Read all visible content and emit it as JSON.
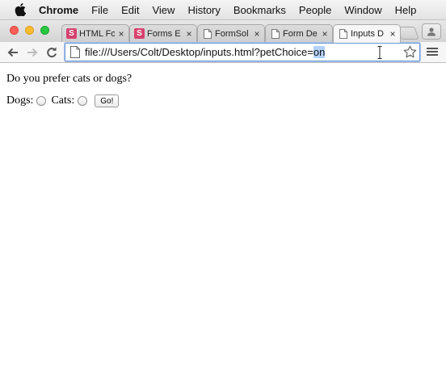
{
  "menubar": {
    "app_name": "Chrome",
    "items": [
      "File",
      "Edit",
      "View",
      "History",
      "Bookmarks",
      "People",
      "Window",
      "Help"
    ]
  },
  "tabs": [
    {
      "title": "HTML Fo",
      "favicon": "s-icon",
      "close": "×",
      "active": false
    },
    {
      "title": "Forms E",
      "favicon": "s-icon",
      "close": "×",
      "active": false
    },
    {
      "title": "FormSol",
      "favicon": "document-icon",
      "close": "×",
      "active": false
    },
    {
      "title": "Form De",
      "favicon": "document-icon",
      "close": "×",
      "active": false
    },
    {
      "title": "Inputs D",
      "favicon": "document-icon",
      "close": "×",
      "active": true
    }
  ],
  "omnibox": {
    "url_prefix": "file:///Users/Colt/Desktop/inputs.html?petChoice=",
    "url_selected": "on"
  },
  "page": {
    "question": "Do you prefer cats or dogs?",
    "dogs_label": "Dogs:",
    "cats_label": "Cats:",
    "submit_label": "Go!"
  },
  "colors": {
    "favicon_s": "#d6426e",
    "omnibox_border": "#6c98d6",
    "selection": "#b3d2fb"
  }
}
